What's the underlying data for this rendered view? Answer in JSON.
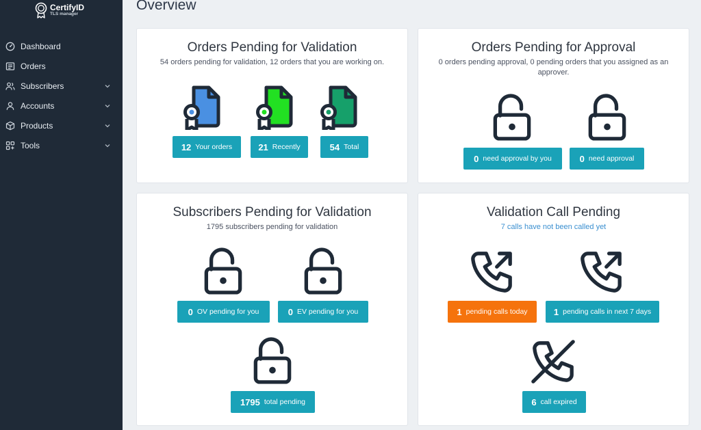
{
  "app": {
    "name": "CertifyID",
    "subtitle": "TLS manager"
  },
  "sidebar": {
    "items": [
      {
        "label": "Dashboard",
        "icon": "gauge-icon",
        "has_submenu": false
      },
      {
        "label": "Orders",
        "icon": "receipt-icon",
        "has_submenu": false
      },
      {
        "label": "Subscribers",
        "icon": "users-icon",
        "has_submenu": true
      },
      {
        "label": "Accounts",
        "icon": "user-icon",
        "has_submenu": true
      },
      {
        "label": "Products",
        "icon": "box-icon",
        "has_submenu": true
      },
      {
        "label": "Tools",
        "icon": "grid-plus-icon",
        "has_submenu": true
      }
    ]
  },
  "page": {
    "title": "Overview"
  },
  "colors": {
    "sidebar": "#1f2a37",
    "teal": "#1aa2b8",
    "orange": "#f5730d",
    "doc_blue": "#4a90e2",
    "doc_green": "#22e022",
    "doc_darkgreen": "#16a06a"
  },
  "cards": {
    "orders_validation": {
      "title": "Orders Pending for Validation",
      "subtitle": "54 orders pending for validation, 12 orders that you are working on.",
      "buttons": [
        {
          "count": "12",
          "label": "Your orders",
          "icon": "certificate-document-blue-icon"
        },
        {
          "count": "21",
          "label": "Recently",
          "icon": "certificate-document-green-icon"
        },
        {
          "count": "54",
          "label": "Total",
          "icon": "certificate-document-darkgreen-icon"
        }
      ]
    },
    "orders_approval": {
      "title": "Orders Pending for Approval",
      "subtitle": "0 orders pending approval, 0 pending orders that you assigned as an approver.",
      "buttons": [
        {
          "count": "0",
          "label": "need approval by you",
          "icon": "unlocked-padlock-icon"
        },
        {
          "count": "0",
          "label": "need approval",
          "icon": "unlocked-padlock-icon"
        }
      ]
    },
    "subscribers_validation": {
      "title": "Subscribers Pending for Validation",
      "subtitle": "1795 subscribers pending for validation",
      "buttons": [
        {
          "count": "0",
          "label": "OV pending for you",
          "icon": "unlocked-padlock-icon"
        },
        {
          "count": "0",
          "label": "EV pending for you",
          "icon": "unlocked-padlock-icon"
        },
        {
          "count": "1795",
          "label": "total pending",
          "icon": "unlocked-padlock-icon"
        }
      ]
    },
    "validation_call": {
      "title": "Validation Call Pending",
      "subtitle": "7 calls have not been called yet",
      "buttons": [
        {
          "count": "1",
          "label": "pending calls today",
          "icon": "phone-outgoing-icon",
          "style": "orange"
        },
        {
          "count": "1",
          "label": "pending calls in next 7 days",
          "icon": "phone-outgoing-icon",
          "style": "teal"
        },
        {
          "count": "6",
          "label": "call expired",
          "icon": "phone-off-icon",
          "style": "teal"
        }
      ]
    }
  }
}
